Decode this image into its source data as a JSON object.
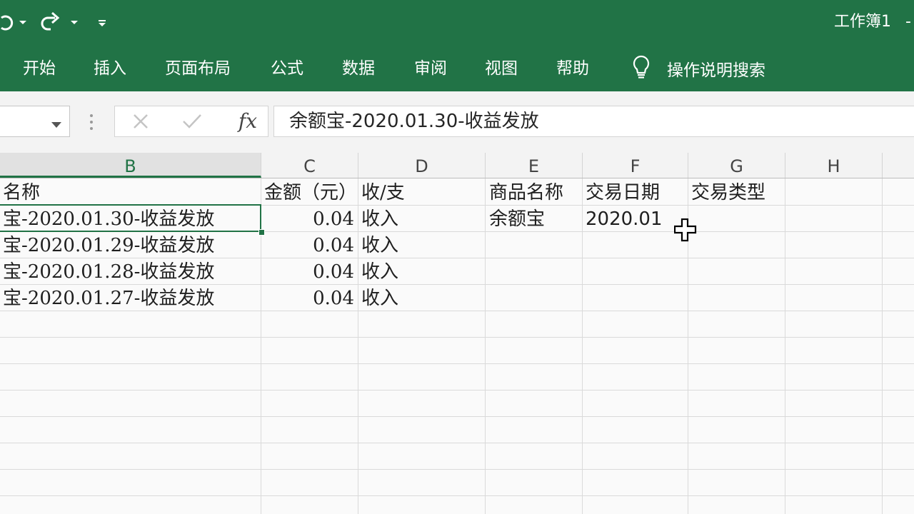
{
  "app": {
    "workbook_title": "工作簿1",
    "title_separator": "-",
    "accent_color": "#217346"
  },
  "quick_access": {
    "icons": [
      "undo-icon",
      "undo-dropdown-icon",
      "redo-icon",
      "redo-dropdown-icon",
      "customize-quick-access-icon"
    ]
  },
  "ribbon": {
    "tabs": [
      {
        "label": "开始"
      },
      {
        "label": "插入"
      },
      {
        "label": "页面布局"
      },
      {
        "label": "公式"
      },
      {
        "label": "数据"
      },
      {
        "label": "审阅"
      },
      {
        "label": "视图"
      },
      {
        "label": "帮助"
      }
    ],
    "tell_me": {
      "label": "操作说明搜索",
      "icon": "lightbulb-icon"
    }
  },
  "formula_bar": {
    "name_box_value": "",
    "fx_label": "fx",
    "formula_value": "余额宝-2020.01.30-收益发放"
  },
  "sheet": {
    "columns": [
      "B",
      "C",
      "D",
      "E",
      "F",
      "G",
      "H"
    ],
    "selected_column": "B",
    "rows": [
      {
        "B": "名称",
        "C": "金额（元）",
        "D": "收/支",
        "E": "商品名称",
        "F": "交易日期",
        "G": "交易类型"
      },
      {
        "B": "宝-2020.01.30-收益发放",
        "C": "0.04",
        "D": "收入",
        "E": "余额宝",
        "F": "2020.01",
        "G": ""
      },
      {
        "B": "宝-2020.01.29-收益发放",
        "C": "0.04",
        "D": "收入",
        "E": "",
        "F": "",
        "G": ""
      },
      {
        "B": "宝-2020.01.28-收益发放",
        "C": "0.04",
        "D": "收入",
        "E": "",
        "F": "",
        "G": ""
      },
      {
        "B": "宝-2020.01.27-收益发放",
        "C": "0.04",
        "D": "收入",
        "E": "",
        "F": "",
        "G": ""
      }
    ],
    "active_cell": "B2",
    "cursor_icon": "plus-select-cursor-icon"
  }
}
